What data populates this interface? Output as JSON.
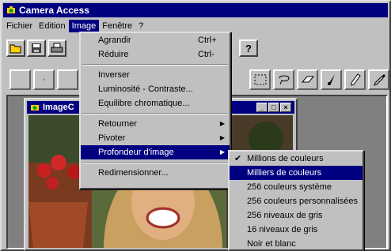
{
  "app": {
    "title": "Camera Access"
  },
  "menubar": [
    "Fichier",
    "Edition",
    "Image",
    "Fenêtre",
    "?"
  ],
  "image_menu": {
    "items": [
      {
        "label": "Agrandir",
        "shortcut": "Ctrl+"
      },
      {
        "label": "Réduire",
        "shortcut": "Ctrl-"
      },
      {
        "label": "Inverser"
      },
      {
        "label": "Luminosité - Contraste..."
      },
      {
        "label": "Equilibre chromatique..."
      },
      {
        "label": "Retourner"
      },
      {
        "label": "Pivoter"
      },
      {
        "label": "Profondeur d'image"
      },
      {
        "label": "Redimensionner..."
      }
    ]
  },
  "depth_menu": {
    "items": [
      "Millions de couleurs",
      "Milliers de couleurs",
      "256 couleurs système",
      "256 couleurs personnalisées",
      "256 niveaux de gris",
      "16 niveaux de gris",
      "Noir et blanc"
    ],
    "checked": "Millions de couleurs",
    "highlighted": "Milliers de couleurs"
  },
  "child": {
    "title": "ImageC"
  },
  "icons": [
    "camera-app-icon",
    "open-icon",
    "save-icon",
    "print-icon",
    "help-icon",
    "select-rect-icon",
    "lasso-icon",
    "eraser-icon",
    "brush-icon",
    "pencil-icon",
    "eyedropper-icon"
  ],
  "colors": {
    "titlebar": "#000080",
    "face": "#c0c0c0",
    "highlight": "#000080"
  }
}
